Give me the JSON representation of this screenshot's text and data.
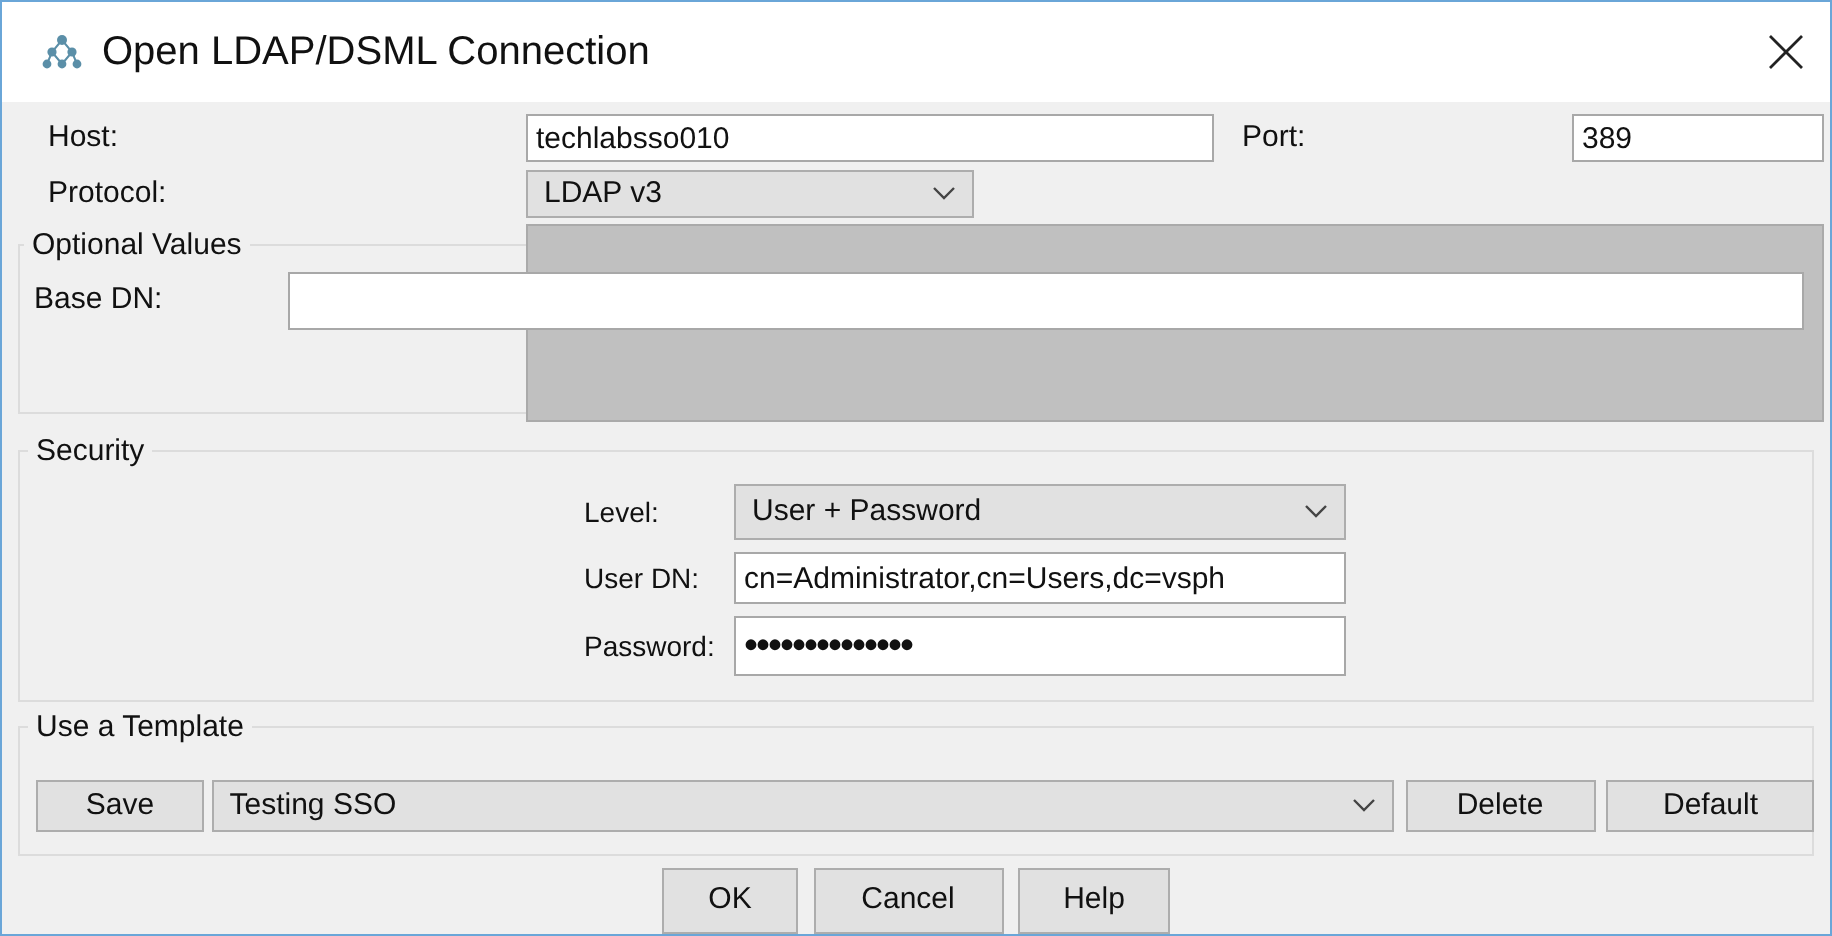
{
  "window": {
    "title": "Open LDAP/DSML Connection"
  },
  "connection": {
    "host_label": "Host:",
    "host": "techlabsso010",
    "port_label": "Port:",
    "port": "389",
    "protocol_label": "Protocol:",
    "protocol": "LDAP v3"
  },
  "optional_values": {
    "title": "Optional Values",
    "base_dn_label": "Base DN:"
  },
  "security": {
    "title": "Security",
    "fields": [
      {
        "label": "Level:",
        "kind": "select",
        "value": "User + Password"
      },
      {
        "label": "User DN:",
        "kind": "text",
        "value": "cn=Administrator,cn=Users,dc=vsph"
      },
      {
        "label": "Password:",
        "kind": "password",
        "value": "••••••••••••••"
      }
    ]
  },
  "template": {
    "title": "Use a Template",
    "save": "Save",
    "selected": "Testing SSO",
    "buttons": [
      "Delete",
      "Default"
    ]
  },
  "buttons": [
    "OK",
    "Cancel",
    "Help"
  ]
}
